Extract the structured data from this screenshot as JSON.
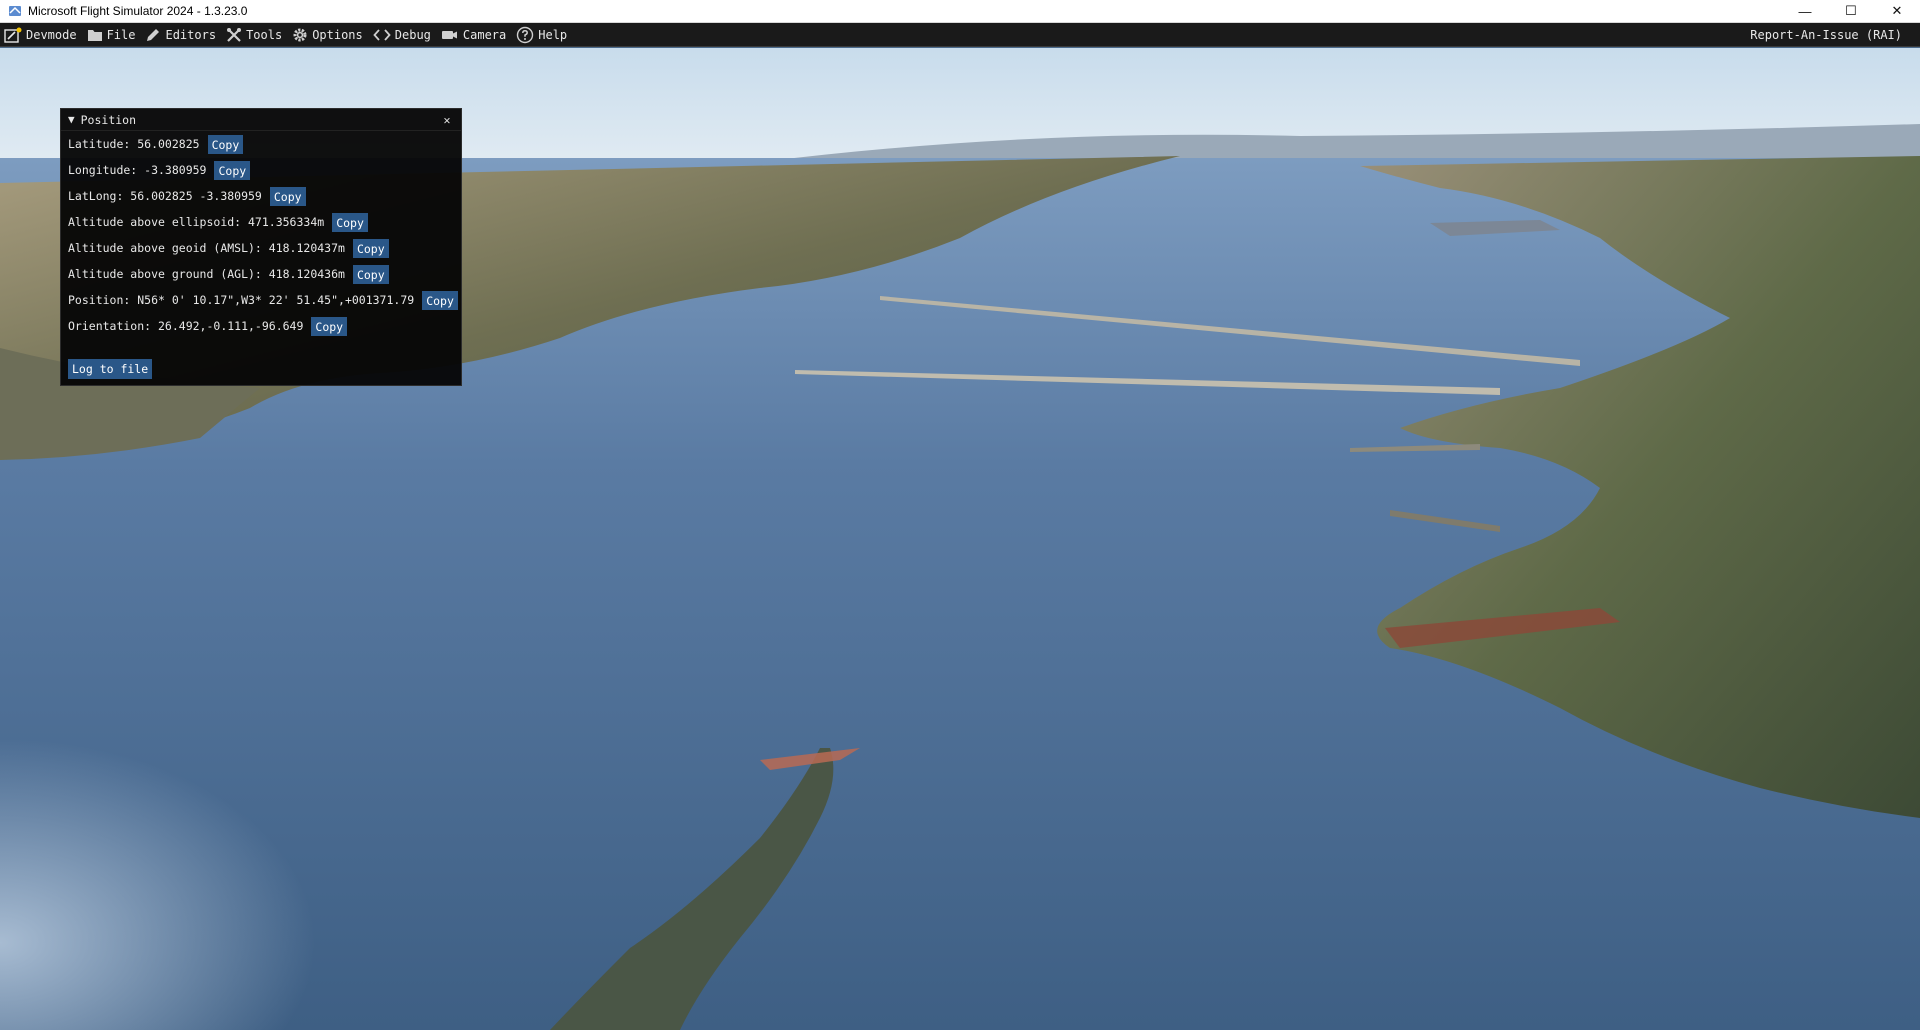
{
  "window": {
    "title": "Microsoft Flight Simulator 2024 - 1.3.23.0",
    "minimize_glyph": "—",
    "maximize_glyph": "☐",
    "close_glyph": "✕"
  },
  "menubar": {
    "items": [
      {
        "label": "Devmode",
        "icon": "devmode-icon"
      },
      {
        "label": "File",
        "icon": "folder-icon"
      },
      {
        "label": "Editors",
        "icon": "pencil-icon"
      },
      {
        "label": "Tools",
        "icon": "tools-icon"
      },
      {
        "label": "Options",
        "icon": "gear-icon"
      },
      {
        "label": "Debug",
        "icon": "code-brackets-icon"
      },
      {
        "label": "Camera",
        "icon": "camera-icon"
      },
      {
        "label": "Help",
        "icon": "help-icon"
      }
    ],
    "right_label": "Report-An-Issue (RAI)"
  },
  "position_panel": {
    "title": "Position",
    "collapse_glyph": "▼",
    "close_glyph": "✕",
    "copy_label": "Copy",
    "rows": [
      {
        "text": "Latitude: 56.002825"
      },
      {
        "text": "Longitude: -3.380959"
      },
      {
        "text": "LatLong: 56.002825 -3.380959"
      },
      {
        "text": "Altitude above ellipsoid: 471.356334m"
      },
      {
        "text": "Altitude above geoid (AMSL): 418.120437m"
      },
      {
        "text": "Altitude above ground (AGL): 418.120436m"
      },
      {
        "text": "Position: N56* 0' 10.17\",W3* 22' 51.45\",+001371.79"
      },
      {
        "text": "Orientation: 26.492,-0.111,-96.649"
      }
    ],
    "log_button_label": "Log to file"
  },
  "colors": {
    "menubar_bg": "#1a1a1a",
    "panel_bg": "#060606",
    "button_blue": "#2a5788",
    "water": "#4d6b8e",
    "sky": "#dbe8f2"
  }
}
